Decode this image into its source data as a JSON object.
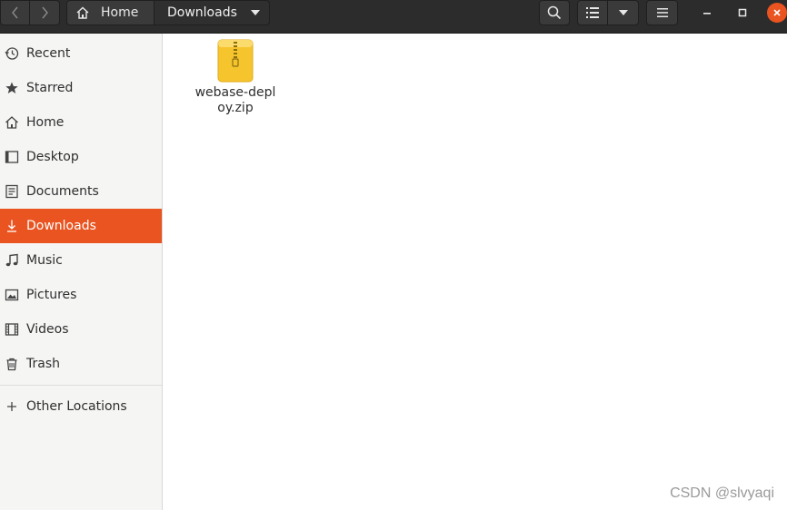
{
  "header": {
    "path": [
      {
        "label": "Home"
      },
      {
        "label": "Downloads"
      }
    ]
  },
  "sidebar": {
    "items": [
      {
        "label": "Recent",
        "icon": "clock-icon"
      },
      {
        "label": "Starred",
        "icon": "star-icon"
      },
      {
        "label": "Home",
        "icon": "home-icon"
      },
      {
        "label": "Desktop",
        "icon": "desktop-icon"
      },
      {
        "label": "Documents",
        "icon": "document-icon"
      },
      {
        "label": "Downloads",
        "icon": "download-icon",
        "active": true
      },
      {
        "label": "Music",
        "icon": "music-icon"
      },
      {
        "label": "Pictures",
        "icon": "picture-icon"
      },
      {
        "label": "Videos",
        "icon": "video-icon"
      },
      {
        "label": "Trash",
        "icon": "trash-icon"
      }
    ],
    "other_locations": "Other Locations"
  },
  "files": [
    {
      "name": "webase-deploy.zip",
      "icon": "zip-archive-icon"
    }
  ],
  "watermark": "CSDN @slvyaqi",
  "colors": {
    "accent": "#e95420",
    "headerbar": "#2c2c2c",
    "sidebar": "#f5f5f4"
  }
}
